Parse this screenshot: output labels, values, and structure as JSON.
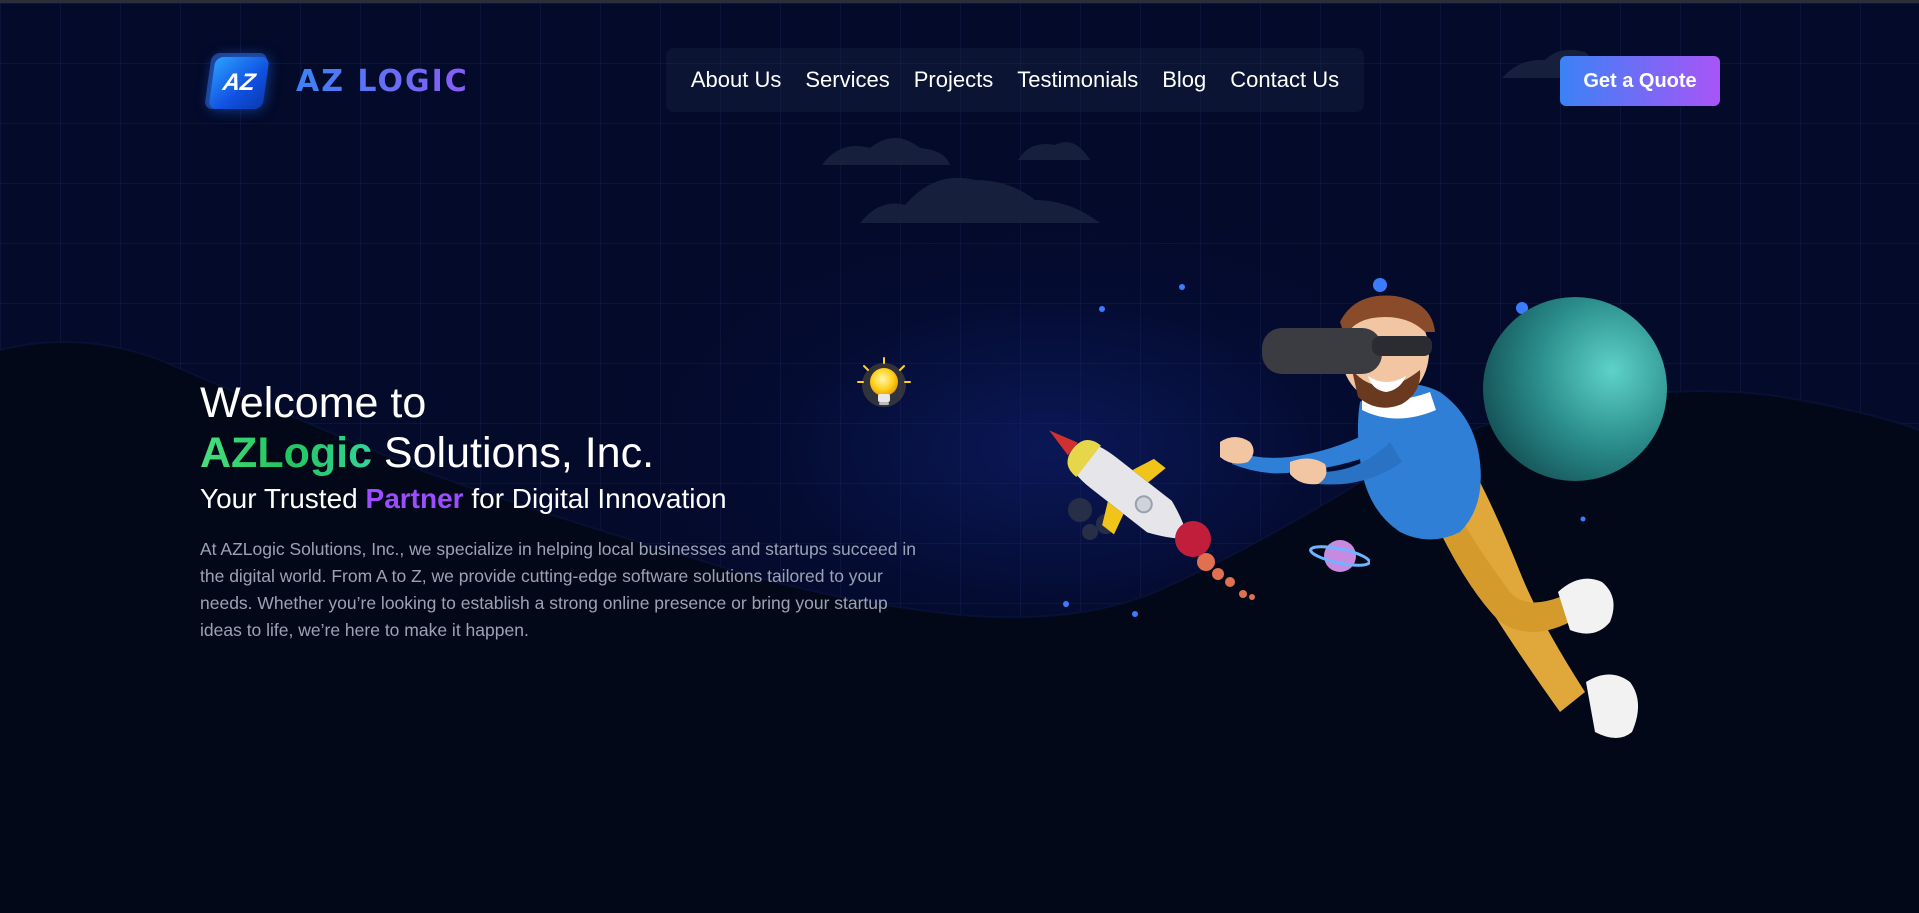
{
  "brand": {
    "badge": "AZ",
    "name": "AZ LOGIC"
  },
  "nav": {
    "items": [
      "About Us",
      "Services",
      "Projects",
      "Testimonials",
      "Blog",
      "Contact Us"
    ]
  },
  "header": {
    "cta_label": "Get a Quote"
  },
  "hero": {
    "line1": "Welcome to",
    "brand_word": "AZLogic",
    "line2_rest": " Solutions, Inc.",
    "tagline_pre": "Your Trusted ",
    "tagline_accent": "Partner",
    "tagline_post": " for Digital Innovation",
    "description": "At AZLogic Solutions, Inc., we specialize in helping local businesses and startups succeed in the digital world. From A to Z, we provide cutting-edge software solutions tailored to your needs. Whether you’re looking to establish a strong online presence or bring your startup ideas to life, we’re here to make it happen."
  },
  "colors": {
    "background": "#020817",
    "accent_blue": "#3b82f6",
    "accent_purple": "#a855f7",
    "brand_green": "#4ade80",
    "partner_purple": "#9d4dff"
  },
  "icons": [
    "lightbulb-icon",
    "rocket-icon",
    "planet-icon",
    "vr-man-illustration"
  ]
}
